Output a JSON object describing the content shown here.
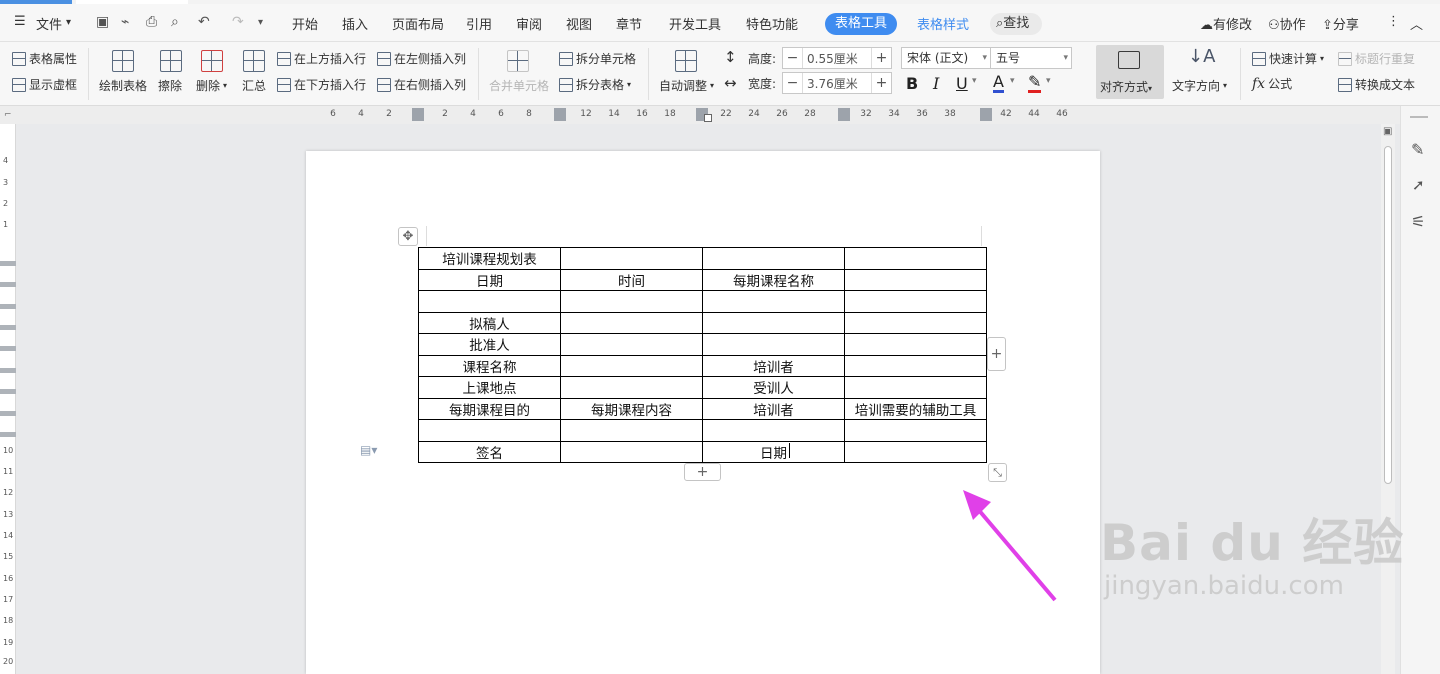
{
  "menubar": {
    "file": "文件",
    "tabs": [
      "开始",
      "插入",
      "页面布局",
      "引用",
      "审阅",
      "视图",
      "章节",
      "开发工具",
      "特色功能"
    ],
    "active_tab": "表格工具",
    "table_style_tab": "表格样式",
    "search": "查找",
    "right": [
      "有修改",
      "协作",
      "分享"
    ]
  },
  "ribbon": {
    "table_props": "表格属性",
    "show_gridlines": "显示虚框",
    "draw_table": "绘制表格",
    "erase": "擦除",
    "delete": "删除",
    "summary": "汇总",
    "insert_above": "在上方插入行",
    "insert_below": "在下方插入行",
    "insert_left": "在左侧插入列",
    "insert_right": "在右侧插入列",
    "merge_cells": "合并单元格",
    "split_cells": "拆分单元格",
    "split_table": "拆分表格",
    "auto_fit": "自动调整",
    "height_label": "高度:",
    "height_value": "0.55厘米",
    "width_label": "宽度:",
    "width_value": "3.76厘米",
    "font_name": "宋体 (正文)",
    "font_size": "五号",
    "bold": "B",
    "italic": "I",
    "underline": "U",
    "font_color": "A",
    "align": "对齐方式",
    "text_direction": "文字方向",
    "quick_calc": "快速计算",
    "repeat_header": "标题行重复",
    "formula": "公式",
    "fx": "fx",
    "to_text": "转换成文本"
  },
  "ruler": {
    "ticks": [
      "6",
      "4",
      "2",
      "2",
      "4",
      "6",
      "8",
      "12",
      "14",
      "16",
      "18",
      "22",
      "24",
      "26",
      "28",
      "32",
      "34",
      "36",
      "38",
      "42",
      "44",
      "46"
    ],
    "vticks": [
      "4",
      "3",
      "2",
      "1",
      "10",
      "11",
      "12",
      "13",
      "14",
      "15",
      "16",
      "17",
      "18",
      "19",
      "20"
    ]
  },
  "table": {
    "rows": [
      [
        "培训课程规划表",
        "",
        "",
        ""
      ],
      [
        "日期",
        "时间",
        "每期课程名称",
        ""
      ],
      [
        "",
        "",
        "",
        ""
      ],
      [
        "拟稿人",
        "",
        "",
        ""
      ],
      [
        "批准人",
        "",
        "",
        ""
      ],
      [
        "课程名称",
        "",
        "培训者",
        ""
      ],
      [
        "上课地点",
        "",
        "受训人",
        ""
      ],
      [
        "每期课程目的",
        "每期课程内容",
        "培训者",
        "培训需要的辅助工具"
      ],
      [
        "",
        "",
        "",
        ""
      ],
      [
        "签名",
        "",
        "日期",
        ""
      ]
    ]
  },
  "colors": {
    "accent": "#3f8cf0",
    "arrow": "#e040e8"
  },
  "watermark": {
    "brand": "Bai du 经验",
    "url": "jingyan.baidu.com"
  }
}
